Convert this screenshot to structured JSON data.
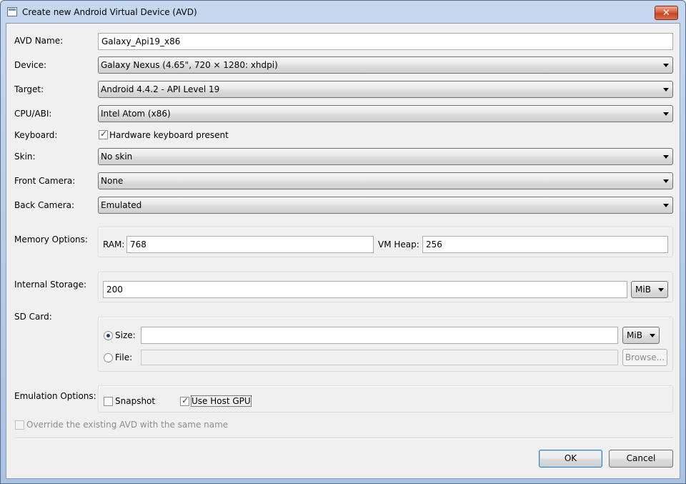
{
  "window": {
    "title": "Create new Android Virtual Device (AVD)",
    "close_label": "✕"
  },
  "form": {
    "avd_name": {
      "label": "AVD Name:",
      "value": "Galaxy_Api19_x86"
    },
    "device": {
      "label": "Device:",
      "value": "Galaxy Nexus (4.65\", 720 × 1280: xhdpi)"
    },
    "target": {
      "label": "Target:",
      "value": "Android 4.4.2 - API Level 19"
    },
    "cpu_abi": {
      "label": "CPU/ABI:",
      "value": "Intel Atom (x86)"
    },
    "keyboard": {
      "label": "Keyboard:",
      "checkbox_label": "Hardware keyboard present",
      "checked": true
    },
    "skin": {
      "label": "Skin:",
      "value": "No skin"
    },
    "front_camera": {
      "label": "Front Camera:",
      "value": "None"
    },
    "back_camera": {
      "label": "Back Camera:",
      "value": "Emulated"
    },
    "memory": {
      "label": "Memory Options:",
      "ram_label": "RAM:",
      "ram_value": "768",
      "vm_heap_label": "VM Heap:",
      "vm_heap_value": "256"
    },
    "internal_storage": {
      "label": "Internal Storage:",
      "value": "200",
      "unit": "MiB"
    },
    "sd_card": {
      "label": "SD Card:",
      "size_label": "Size:",
      "size_value": "",
      "size_unit": "MiB",
      "size_selected": true,
      "file_label": "File:",
      "file_value": "",
      "browse_label": "Browse..."
    },
    "emulation": {
      "label": "Emulation Options:",
      "snapshot_label": "Snapshot",
      "snapshot_checked": false,
      "host_gpu_label": "Use Host GPU",
      "host_gpu_checked": true
    },
    "override": {
      "label": "Override the existing AVD with the same name",
      "checked": false
    }
  },
  "buttons": {
    "ok": "OK",
    "cancel": "Cancel"
  }
}
